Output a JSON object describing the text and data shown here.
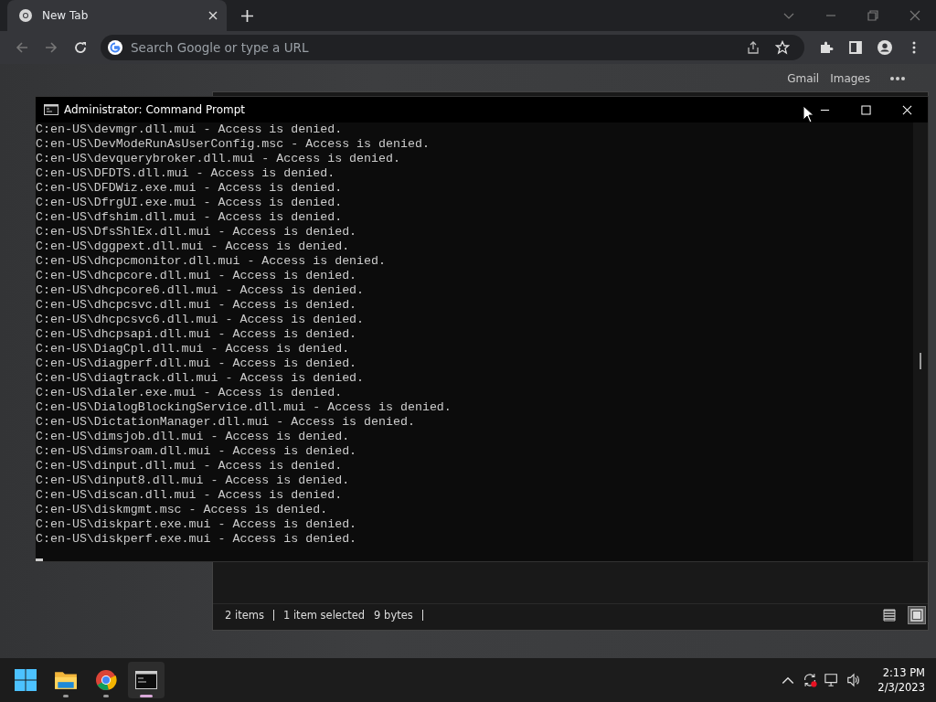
{
  "browser": {
    "tab": {
      "title": "New Tab"
    },
    "address": {
      "placeholder": "Search Google or type a URL"
    },
    "newtab_links": [
      "Gmail",
      "Images"
    ]
  },
  "console": {
    "title": "Administrator:  Command Prompt",
    "lines": [
      "C:en-US\\devmgr.dll.mui - Access is denied.",
      "C:en-US\\DevModeRunAsUserConfig.msc - Access is denied.",
      "C:en-US\\devquerybroker.dll.mui - Access is denied.",
      "C:en-US\\DFDTS.dll.mui - Access is denied.",
      "C:en-US\\DFDWiz.exe.mui - Access is denied.",
      "C:en-US\\DfrgUI.exe.mui - Access is denied.",
      "C:en-US\\dfshim.dll.mui - Access is denied.",
      "C:en-US\\DfsShlEx.dll.mui - Access is denied.",
      "C:en-US\\dggpext.dll.mui - Access is denied.",
      "C:en-US\\dhcpcmonitor.dll.mui - Access is denied.",
      "C:en-US\\dhcpcore.dll.mui - Access is denied.",
      "C:en-US\\dhcpcore6.dll.mui - Access is denied.",
      "C:en-US\\dhcpcsvc.dll.mui - Access is denied.",
      "C:en-US\\dhcpcsvc6.dll.mui - Access is denied.",
      "C:en-US\\dhcpsapi.dll.mui - Access is denied.",
      "C:en-US\\DiagCpl.dll.mui - Access is denied.",
      "C:en-US\\diagperf.dll.mui - Access is denied.",
      "C:en-US\\diagtrack.dll.mui - Access is denied.",
      "C:en-US\\dialer.exe.mui - Access is denied.",
      "C:en-US\\DialogBlockingService.dll.mui - Access is denied.",
      "C:en-US\\DictationManager.dll.mui - Access is denied.",
      "C:en-US\\dimsjob.dll.mui - Access is denied.",
      "C:en-US\\dimsroam.dll.mui - Access is denied.",
      "C:en-US\\dinput.dll.mui - Access is denied.",
      "C:en-US\\dinput8.dll.mui - Access is denied.",
      "C:en-US\\discan.dll.mui - Access is denied.",
      "C:en-US\\diskmgmt.msc - Access is denied.",
      "C:en-US\\diskpart.exe.mui - Access is denied.",
      "C:en-US\\diskperf.exe.mui - Access is denied."
    ]
  },
  "explorer": {
    "status": [
      "2 items",
      "1 item selected",
      "9 bytes"
    ],
    "views": [
      {
        "kind": "details",
        "selected": false
      },
      {
        "kind": "preview",
        "selected": true
      }
    ]
  },
  "taskbar": {
    "apps": [
      {
        "kind": "start",
        "running": false,
        "active": false
      },
      {
        "kind": "folder",
        "running": true,
        "active": false
      },
      {
        "kind": "chrome",
        "running": true,
        "active": false
      },
      {
        "kind": "terminal",
        "running": true,
        "active": true
      }
    ],
    "time": "2:13 PM",
    "date": "2/3/2023"
  }
}
